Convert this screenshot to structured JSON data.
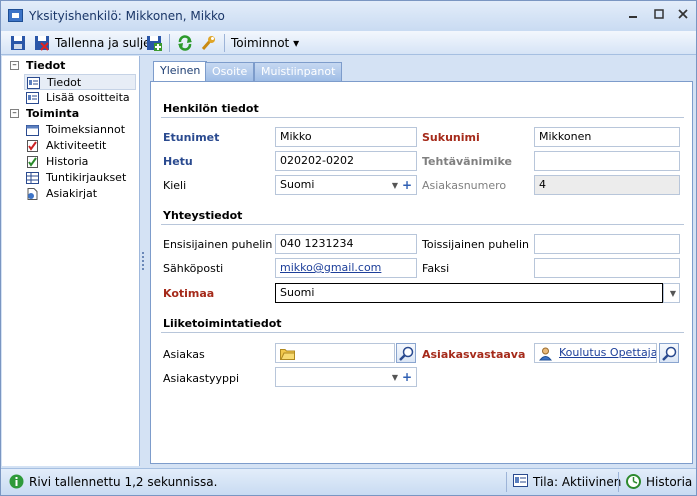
{
  "window": {
    "title": "Yksityishenkilö: Mikkonen, Mikko"
  },
  "toolbar": {
    "save_close_label": "Tallenna ja sulje",
    "actions_label": "Toiminnot ▾"
  },
  "nav": {
    "groups": [
      {
        "label": "Tiedot",
        "items": [
          {
            "label": "Tiedot"
          },
          {
            "label": "Lisää osoitteita"
          }
        ]
      },
      {
        "label": "Toiminta",
        "items": [
          {
            "label": "Toimeksiannot"
          },
          {
            "label": "Aktiviteetit"
          },
          {
            "label": "Historia"
          },
          {
            "label": "Tuntikirjaukset"
          },
          {
            "label": "Asiakirjat"
          }
        ]
      }
    ]
  },
  "tabs": [
    {
      "label": "Yleinen"
    },
    {
      "label": "Osoite"
    },
    {
      "label": "Muistiinpanot"
    }
  ],
  "person": {
    "section_title": "Henkilön tiedot",
    "first_name_label": "Etunimet",
    "first_name_value": "Mikko",
    "last_name_label": "Sukunimi",
    "last_name_value": "Mikkonen",
    "ssn_label": "Hetu",
    "ssn_value": "020202-0202",
    "job_title_label": "Tehtävänimike",
    "job_title_value": "",
    "language_label": "Kieli",
    "language_value": "Suomi",
    "customer_no_label": "Asiakasnumero",
    "customer_no_value": "4"
  },
  "contact": {
    "section_title": "Yhteystiedot",
    "phone1_label": "Ensisijainen puhelin",
    "phone1_value": "040 1231234",
    "phone2_label": "Toissijainen puhelin",
    "phone2_value": "",
    "email_label": "Sähköposti",
    "email_value": "mikko@gmail.com",
    "fax_label": "Faksi",
    "fax_value": "",
    "country_label": "Kotimaa",
    "country_value": "Suomi"
  },
  "business": {
    "section_title": "Liiketoimintatiedot",
    "customer_label": "Asiakas",
    "customer_value": "",
    "account_manager_label": "Asiakasvastaava",
    "account_manager_value": "Koulutus Opettaja",
    "customer_type_label": "Asiakastyyppi",
    "customer_type_value": ""
  },
  "status": {
    "message": "Rivi tallennettu 1,2 sekunnissa.",
    "state": "Tila: Aktiivinen",
    "history": "Historia"
  }
}
